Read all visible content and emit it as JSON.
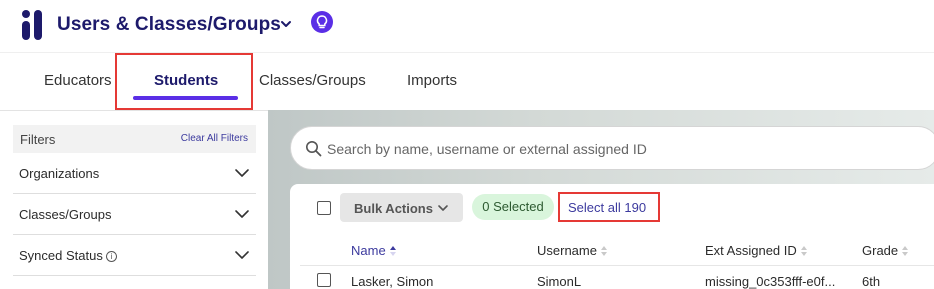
{
  "header": {
    "app_title": "Users & Classes/Groups",
    "logo_icon": "logo-icon",
    "lightbulb_icon": "lightbulb-icon",
    "brand_color": "#1d1a6b",
    "accent_color": "#5a2ee6"
  },
  "tabs": [
    {
      "label": "Educators",
      "active": false
    },
    {
      "label": "Students",
      "active": true
    },
    {
      "label": "Classes/Groups",
      "active": false
    },
    {
      "label": "Imports",
      "active": false
    }
  ],
  "filters": {
    "title": "Filters",
    "clear_label": "Clear All Filters",
    "items": [
      {
        "label": "Organizations"
      },
      {
        "label": "Classes/Groups"
      },
      {
        "label": "Synced Status"
      }
    ]
  },
  "search": {
    "placeholder": "Search by name, username or external assigned ID",
    "value": ""
  },
  "toolbar": {
    "bulk_actions_label": "Bulk Actions",
    "selected_label": "0 Selected",
    "select_all_label": "Select all 190"
  },
  "table": {
    "columns": [
      {
        "label": "Name",
        "sorted": true
      },
      {
        "label": "Username",
        "sorted": false
      },
      {
        "label": "Ext Assigned ID",
        "sorted": false
      },
      {
        "label": "Grade",
        "sorted": false
      }
    ],
    "rows": [
      {
        "name": "Lasker, Simon",
        "username": "SimonL",
        "ext_id": "missing_0c353fff-e0f...",
        "grade": "6th"
      }
    ]
  },
  "highlight_color": "#e53935"
}
